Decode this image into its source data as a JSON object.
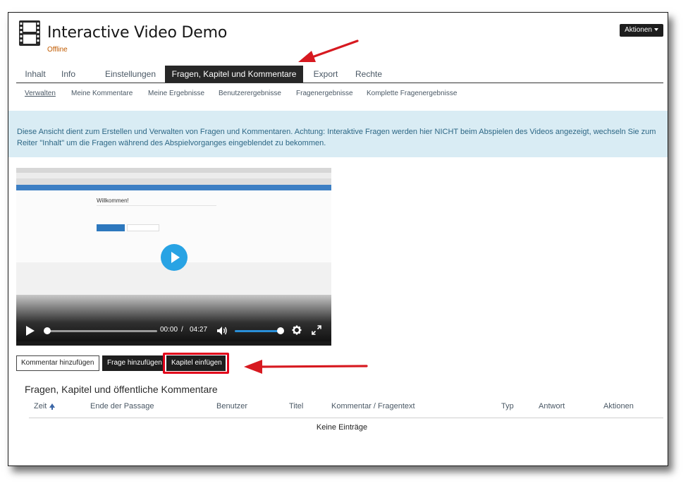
{
  "header": {
    "title": "Interactive Video Demo",
    "status": "Offline",
    "actions_label": "Aktionen"
  },
  "tabs": [
    {
      "label": "Inhalt"
    },
    {
      "label": "Info"
    },
    {
      "label": "Einstellungen"
    },
    {
      "label": "Fragen, Kapitel und Kommentare"
    },
    {
      "label": "Export"
    },
    {
      "label": "Rechte"
    }
  ],
  "subtabs": [
    {
      "label": "Verwalten"
    },
    {
      "label": "Meine Kommentare"
    },
    {
      "label": "Meine Ergebnisse"
    },
    {
      "label": "Benutzerergebnisse"
    },
    {
      "label": "Fragenergebnisse"
    },
    {
      "label": "Komplette Fragenergebnisse"
    }
  ],
  "info_text": "Diese Ansicht dient zum Erstellen und Verwalten von Fragen und Kommentaren. Achtung: Interaktive Fragen werden hier NICHT beim Abspielen des Videos angezeigt, wechseln Sie zum Reiter \"Inhalt\" um die Fragen während des Abspielvorganges eingeblendet zu bekommen.",
  "video": {
    "thumb_title": "Willkommen!",
    "time_current": "00:00",
    "time_separator": "/",
    "time_total": "04:27",
    "progress": 0,
    "volume": 1
  },
  "buttons": {
    "add_comment": "Kommentar hinzufügen",
    "add_question": "Frage hinzufügen",
    "insert_chapter": "Kapitel einfügen"
  },
  "table": {
    "title": "Fragen, Kapitel und öffentliche Kommentare",
    "columns": [
      "Zeit",
      "Ende der Passage",
      "Benutzer",
      "Titel",
      "Kommentar / Fragentext",
      "Typ",
      "Antwort",
      "Aktionen"
    ],
    "empty_text": "Keine Einträge"
  },
  "colors": {
    "accent_red": "#e1001a",
    "player_blue": "#28a3e4",
    "info_bg": "#d9ecf4"
  }
}
